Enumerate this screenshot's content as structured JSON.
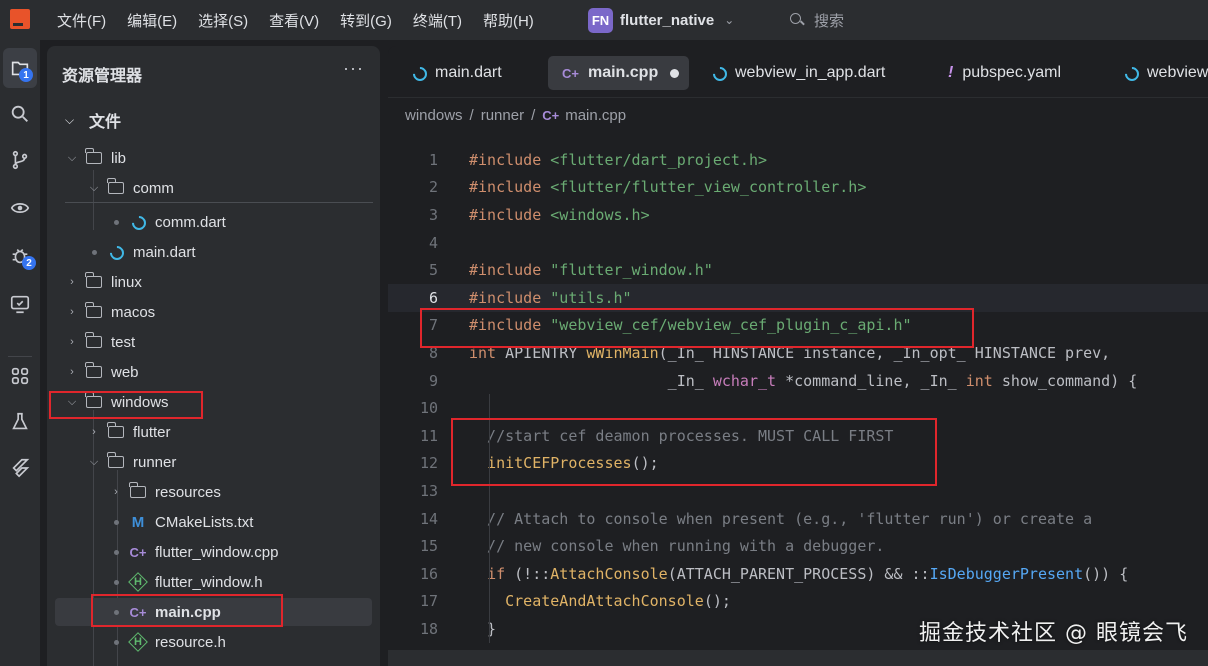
{
  "menubar": {
    "items": [
      "文件(F)",
      "编辑(E)",
      "选择(S)",
      "查看(V)",
      "转到(G)",
      "终端(T)",
      "帮助(H)"
    ],
    "project_badge": "FN",
    "project_name": "flutter_native",
    "search_label": "搜索"
  },
  "activity": {
    "explorer_badge": "1",
    "debug_badge": "2"
  },
  "explorer": {
    "title": "资源管理器",
    "more": "···",
    "section_label": "文件",
    "items": [
      {
        "label": "lib",
        "kind": "folder",
        "expanded": true
      },
      {
        "label": "comm",
        "kind": "folder",
        "expanded": true
      },
      {
        "label": "comm.dart",
        "kind": "dart"
      },
      {
        "label": "main.dart",
        "kind": "dart"
      },
      {
        "label": "linux",
        "kind": "folder",
        "expanded": false
      },
      {
        "label": "macos",
        "kind": "folder",
        "expanded": false
      },
      {
        "label": "test",
        "kind": "folder",
        "expanded": false
      },
      {
        "label": "web",
        "kind": "folder",
        "expanded": false
      },
      {
        "label": "windows",
        "kind": "folder",
        "expanded": true
      },
      {
        "label": "flutter",
        "kind": "folder",
        "expanded": false
      },
      {
        "label": "runner",
        "kind": "folder",
        "expanded": true
      },
      {
        "label": "resources",
        "kind": "folder",
        "expanded": false
      },
      {
        "label": "CMakeLists.txt",
        "kind": "cmake"
      },
      {
        "label": "flutter_window.cpp",
        "kind": "cpp"
      },
      {
        "label": "flutter_window.h",
        "kind": "h"
      },
      {
        "label": "main.cpp",
        "kind": "cpp",
        "selected": true
      },
      {
        "label": "resource.h",
        "kind": "h"
      }
    ]
  },
  "editor": {
    "tabs": [
      {
        "label": "main.dart",
        "kind": "dart"
      },
      {
        "label": "main.cpp",
        "kind": "cpp",
        "active": true,
        "modified": true
      },
      {
        "label": "webview_in_app.dart",
        "kind": "dart"
      },
      {
        "label": "pubspec.yaml",
        "kind": "yaml"
      },
      {
        "label": "webview",
        "kind": "dart"
      }
    ],
    "breadcrumb": [
      "windows",
      "runner",
      "main.cpp"
    ],
    "current_line": 6,
    "lines": [
      {
        "n": "1",
        "text": "#include <flutter/dart_project.h>"
      },
      {
        "n": "2",
        "text": "#include <flutter/flutter_view_controller.h>"
      },
      {
        "n": "3",
        "text": "#include <windows.h>"
      },
      {
        "n": "4",
        "text": ""
      },
      {
        "n": "5",
        "text": "#include \"flutter_window.h\""
      },
      {
        "n": "6",
        "text": "#include \"utils.h\""
      },
      {
        "n": "7",
        "text": "#include \"webview_cef/webview_cef_plugin_c_api.h\""
      },
      {
        "n": "8",
        "text": "int APIENTRY wWinMain(_In_ HINSTANCE instance, _In_opt_ HINSTANCE prev,"
      },
      {
        "n": "9",
        "text": "                      _In_ wchar_t *command_line, _In_ int show_command) {"
      },
      {
        "n": "10",
        "text": ""
      },
      {
        "n": "11",
        "text": "  //start cef deamon processes. MUST CALL FIRST"
      },
      {
        "n": "12",
        "text": "  initCEFProcesses();"
      },
      {
        "n": "13",
        "text": ""
      },
      {
        "n": "14",
        "text": "  // Attach to console when present (e.g., 'flutter run') or create a"
      },
      {
        "n": "15",
        "text": "  // new console when running with a debugger."
      },
      {
        "n": "16",
        "text": "  if (!::AttachConsole(ATTACH_PARENT_PROCESS) && ::IsDebuggerPresent()) {"
      },
      {
        "n": "17",
        "text": "    CreateAndAttachConsole();"
      },
      {
        "n": "18",
        "text": "  }"
      }
    ]
  },
  "watermark": "掘金技术社区 @ 眼镜会飞",
  "colors": {
    "highlight_box": "#e0262c",
    "accent": "#3574f0",
    "project_badge": "#7b68c9"
  }
}
